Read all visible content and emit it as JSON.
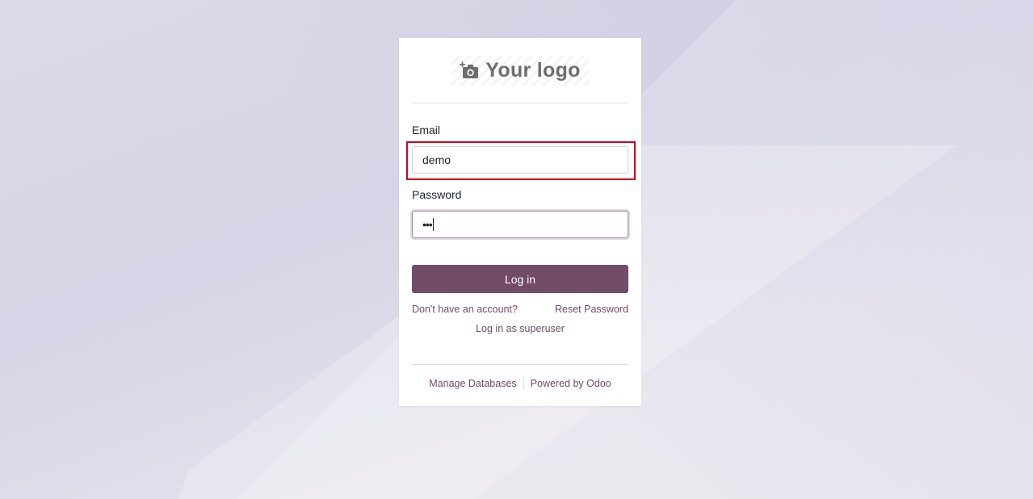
{
  "logo": {
    "text": "Your logo",
    "icon": "camera-plus-icon"
  },
  "form": {
    "email_label": "Email",
    "email_value": "demo",
    "password_label": "Password",
    "password_value": "•••",
    "login_label": "Log in"
  },
  "links": {
    "signup": "Don't have an account?",
    "reset": "Reset Password",
    "superuser": "Log in as superuser"
  },
  "footer": {
    "manage": "Manage Databases",
    "powered_prefix": "Powered by ",
    "powered_brand": "Odoo"
  },
  "colors": {
    "brand": "#714b67",
    "highlight": "#d0021b"
  }
}
